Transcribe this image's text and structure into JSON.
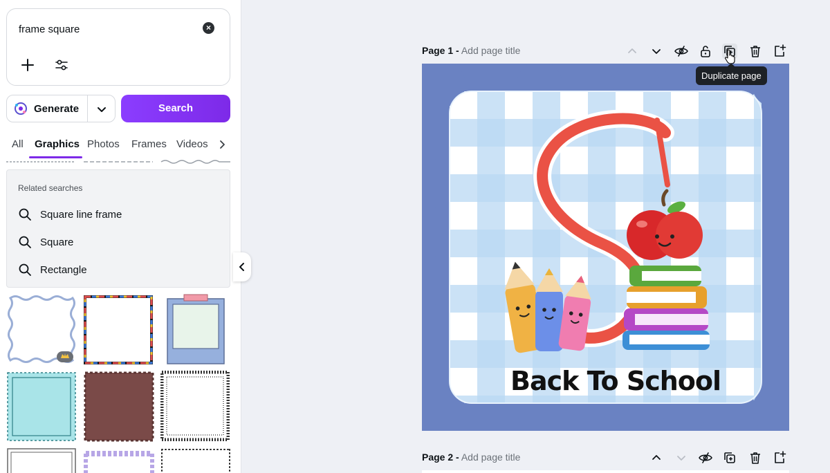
{
  "search": {
    "query": "frame square",
    "clear_icon": "close-circle-icon",
    "add_icon": "plus-icon",
    "filter_icon": "sliders-icon"
  },
  "actions": {
    "generate_label": "Generate",
    "search_label": "Search"
  },
  "tabs": [
    "All",
    "Graphics",
    "Photos",
    "Frames",
    "Videos"
  ],
  "active_tab": "Graphics",
  "related": {
    "title": "Related searches",
    "items": [
      "Square line frame",
      "Square",
      "Rectangle"
    ]
  },
  "pages": [
    {
      "label": "Page 1 -",
      "title_placeholder": "Add page title"
    },
    {
      "label": "Page 2 -",
      "title_placeholder": "Add page title"
    }
  ],
  "tooltip": "Duplicate page",
  "design": {
    "headline": "Back To School",
    "colors": {
      "scallop": "#6a82c2",
      "gingham": "#b9d8f2",
      "letter": "#ea5245",
      "accent": "#7d2ae8"
    }
  }
}
